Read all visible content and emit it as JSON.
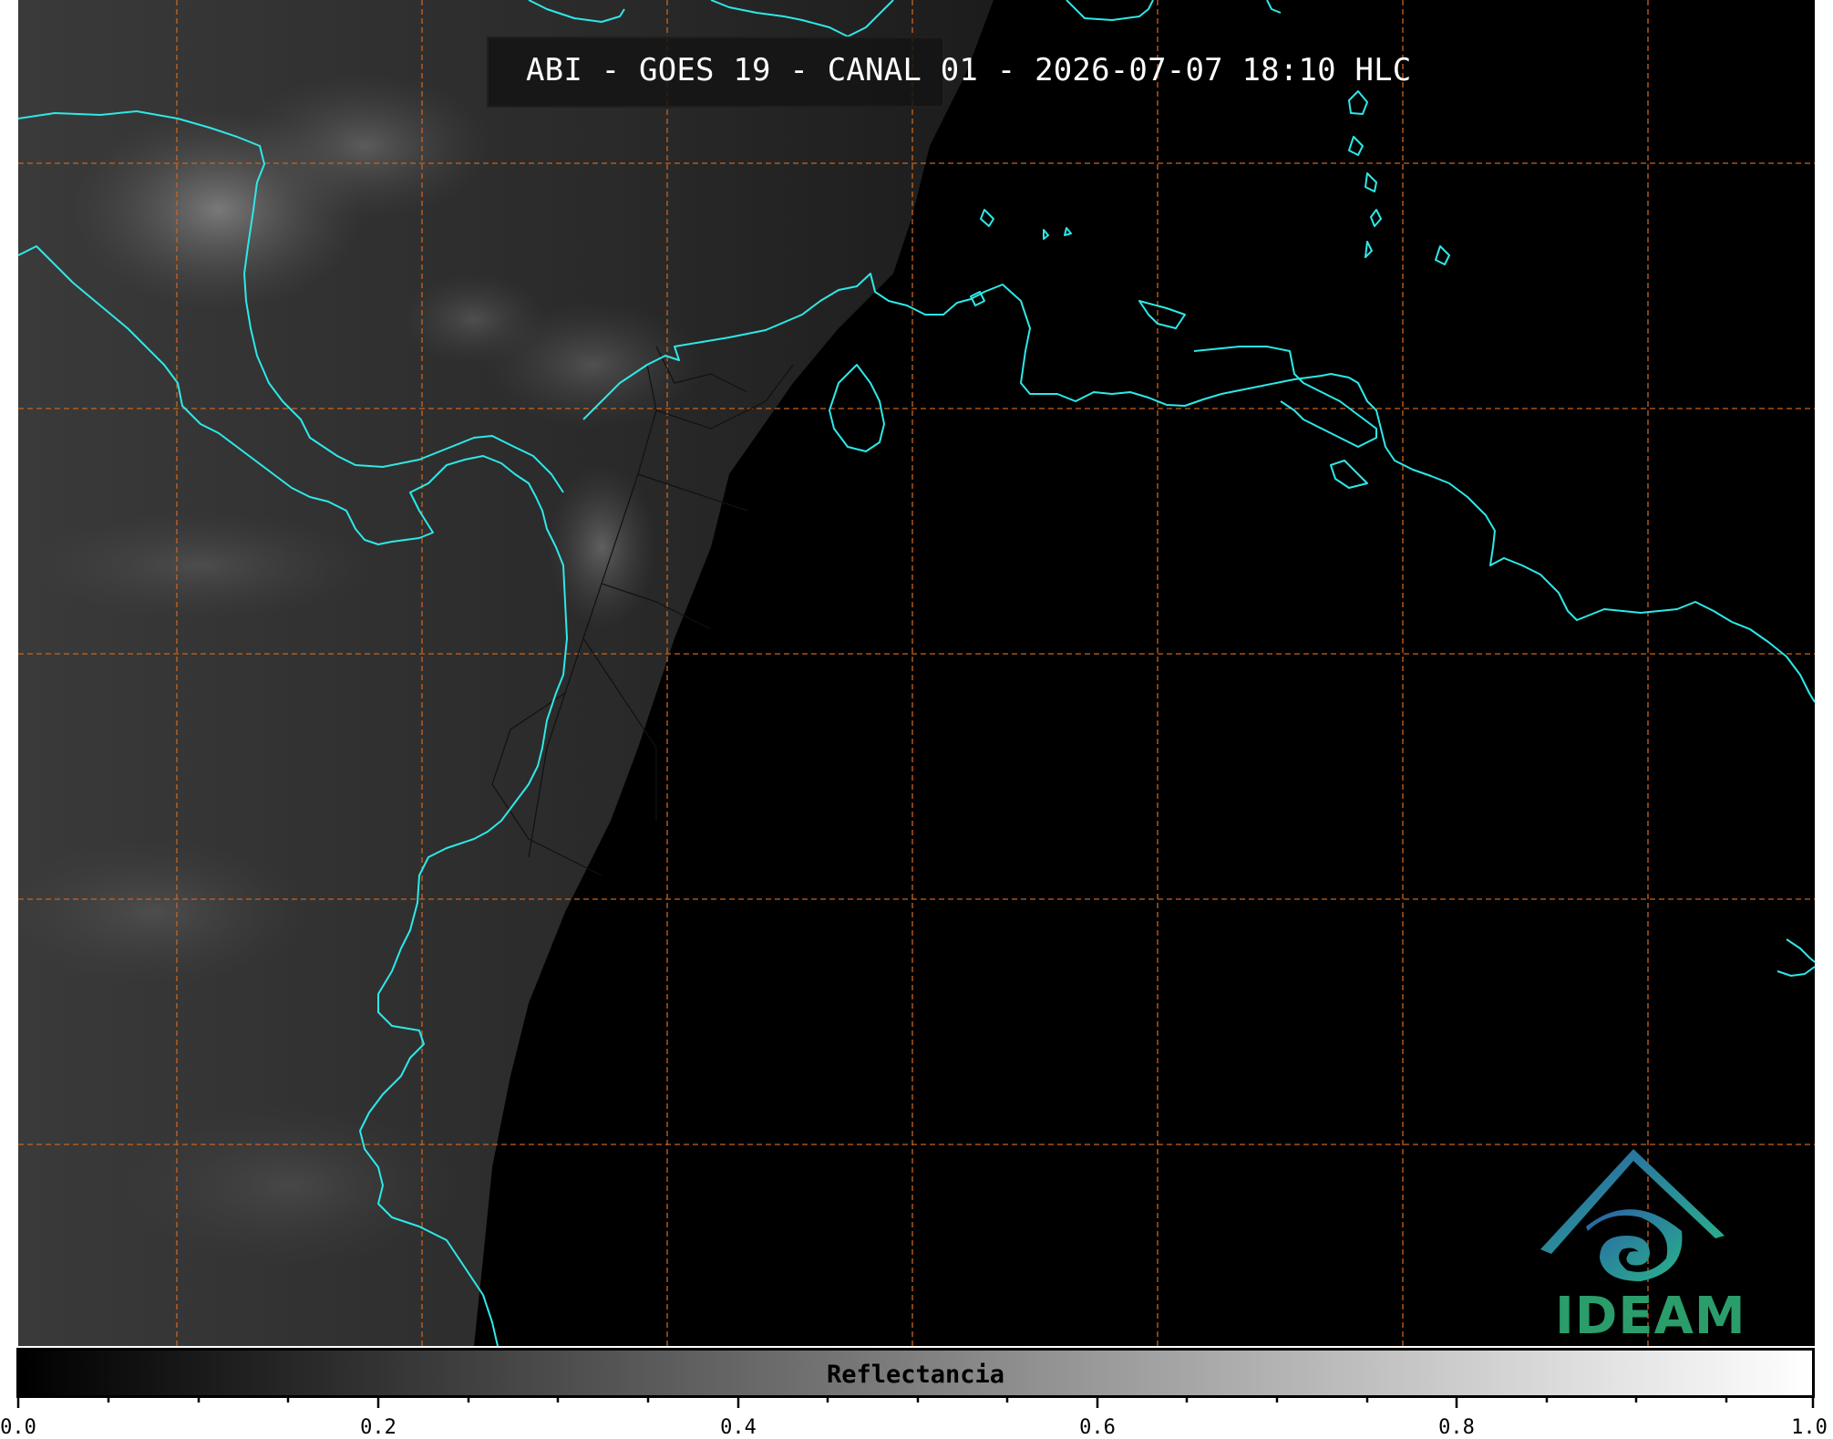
{
  "title": "ABI - GOES 19 - CANAL 01 - 2026-07-07 18:10 HLC",
  "colorbar": {
    "label": "Reflectancia",
    "min": 0.0,
    "max": 1.0,
    "ticks": [
      "0.0",
      "0.2",
      "0.4",
      "0.6",
      "0.8",
      "1.0"
    ],
    "gradient_start": "#000000",
    "gradient_end": "#ffffff"
  },
  "logo": {
    "text": "IDEAM",
    "color": "#2a9d6b"
  },
  "map": {
    "coastline_color": "#2ee8e8",
    "grid_color": "#c8641e",
    "background_color": "#000000",
    "grid_style": "dashed"
  }
}
